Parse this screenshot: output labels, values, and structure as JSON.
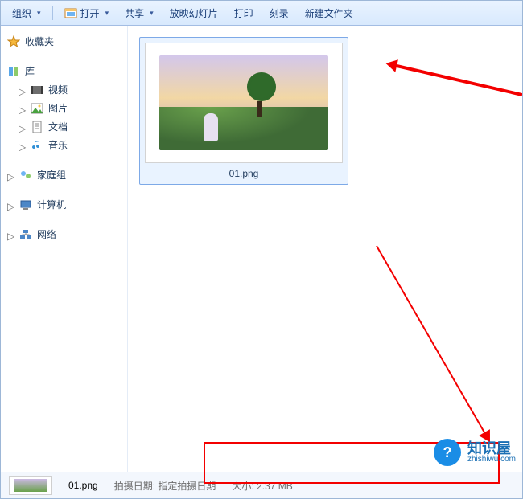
{
  "toolbar": {
    "organize": "组织",
    "open": "打开",
    "share": "共享",
    "slideshow": "放映幻灯片",
    "print": "打印",
    "burn": "刻录",
    "new_folder": "新建文件夹"
  },
  "sidebar": {
    "favorites": "收藏夹",
    "libraries": "库",
    "lib_items": [
      "视频",
      "图片",
      "文档",
      "音乐"
    ],
    "homegroup": "家庭组",
    "computer": "计算机",
    "network": "网络"
  },
  "file": {
    "name": "01.png"
  },
  "statusbar": {
    "name": "01.png",
    "date_label": "拍摄日期:",
    "date_value": "指定拍摄日期",
    "size_label": "大小:",
    "size_value": "2.37 MB"
  },
  "watermark": {
    "cn": "知识屋",
    "en": "zhishiwu.com",
    "badge": "?"
  }
}
